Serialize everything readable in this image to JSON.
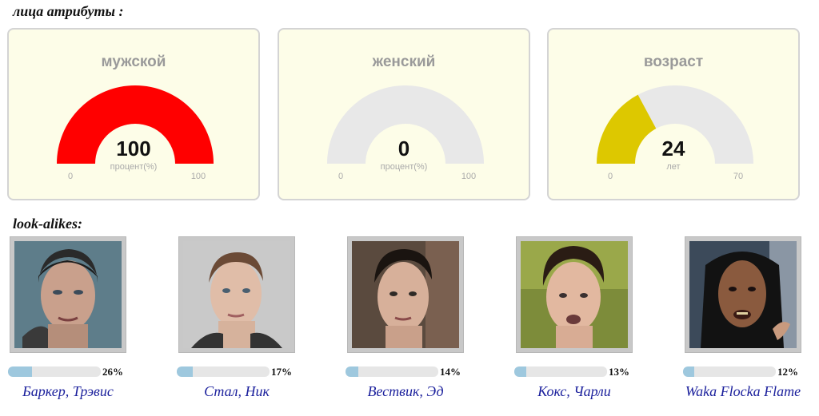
{
  "attributes_heading": "лица атрибуты :",
  "gauges": [
    {
      "title": "мужской",
      "value": "100",
      "unit": "процент(%)",
      "min": "0",
      "max": "100",
      "fraction": 1.0,
      "color": "#ff0000"
    },
    {
      "title": "женский",
      "value": "0",
      "unit": "процент(%)",
      "min": "0",
      "max": "100",
      "fraction": 0.0,
      "color": "#ff0000"
    },
    {
      "title": "возраст",
      "value": "24",
      "unit": "лет",
      "min": "0",
      "max": "70",
      "fraction": 0.343,
      "color": "#ddc800"
    }
  ],
  "track_color": "#e8e8e8",
  "lookalikes_heading": "look-alikes:",
  "lookalikes": [
    {
      "name": "Баркер, Трэвис",
      "percent": "26%",
      "similarity": 0.26,
      "icon": "face-photo"
    },
    {
      "name": "Стал, Ник",
      "percent": "17%",
      "similarity": 0.17,
      "icon": "face-photo"
    },
    {
      "name": "Вествик, Эд",
      "percent": "14%",
      "similarity": 0.14,
      "icon": "face-photo"
    },
    {
      "name": "Кокс, Чарли",
      "percent": "13%",
      "similarity": 0.13,
      "icon": "face-photo"
    },
    {
      "name": "Waka Flocka Flame",
      "percent": "12%",
      "similarity": 0.12,
      "icon": "face-photo"
    }
  ]
}
